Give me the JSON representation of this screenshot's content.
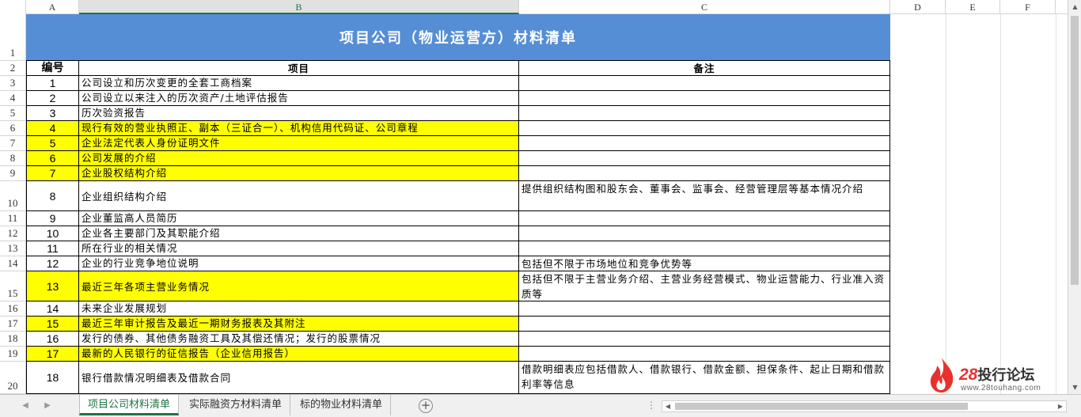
{
  "columns": [
    "A",
    "B",
    "C",
    "D",
    "E",
    "F"
  ],
  "rows": [
    "1",
    "2",
    "3",
    "4",
    "5",
    "6",
    "7",
    "8",
    "9",
    "10",
    "11",
    "12",
    "13",
    "14",
    "15",
    "16",
    "17",
    "18",
    "19",
    "20"
  ],
  "title": "项目公司（物业运营方）材料清单",
  "header": {
    "num": "编号",
    "item": "项目",
    "note": "备注"
  },
  "items": [
    {
      "num": "1",
      "item": "公司设立和历次变更的全套工商档案",
      "note": "",
      "highlight": false
    },
    {
      "num": "2",
      "item": "公司设立以来注入的历次资产/土地评估报告",
      "note": "",
      "highlight": false
    },
    {
      "num": "3",
      "item": "历次验资报告",
      "note": "",
      "highlight": false
    },
    {
      "num": "4",
      "item": "现行有效的营业执照正、副本（三证合一）、机构信用代码证、公司章程",
      "note": "",
      "highlight": true
    },
    {
      "num": "5",
      "item": "企业法定代表人身份证明文件",
      "note": "",
      "highlight": true
    },
    {
      "num": "6",
      "item": "公司发展的介绍",
      "note": "",
      "highlight": true
    },
    {
      "num": "7",
      "item": "企业股权结构介绍",
      "note": "",
      "highlight": true
    },
    {
      "num": "8",
      "item": "企业组织结构介绍",
      "note": "提供组织结构图和股东会、董事会、监事会、经营管理层等基本情况介绍",
      "highlight": false
    },
    {
      "num": "9",
      "item": "企业董监高人员简历",
      "note": "",
      "highlight": false
    },
    {
      "num": "10",
      "item": "企业各主要部门及其职能介绍",
      "note": "",
      "highlight": false
    },
    {
      "num": "11",
      "item": "所在行业的相关情况",
      "note": "",
      "highlight": false
    },
    {
      "num": "12",
      "item": "企业的行业竞争地位说明",
      "note": "包括但不限于市场地位和竞争优势等",
      "highlight": false
    },
    {
      "num": "13",
      "item": "最近三年各项主营业务情况",
      "note": "包括但不限于主营业务介绍、主营业务经营模式、物业运营能力、行业准入资质等",
      "highlight": true
    },
    {
      "num": "14",
      "item": "未来企业发展规划",
      "note": "",
      "highlight": false
    },
    {
      "num": "15",
      "item": "最近三年审计报告及最近一期财务报表及其附注",
      "note": "",
      "highlight": true
    },
    {
      "num": "16",
      "item": "发行的债券、其他债务融资工具及其偿还情况；发行的股票情况",
      "note": "",
      "highlight": false
    },
    {
      "num": "17",
      "item": "最新的人民银行的征信报告（企业信用报告）",
      "note": "",
      "highlight": true
    },
    {
      "num": "18",
      "item": "银行借款情况明细表及借款合同",
      "note": "借款明细表应包括借款人、借款银行、借款金额、担保条件、起止日期和借款利率等信息",
      "highlight": false
    }
  ],
  "sheet_tabs": [
    {
      "label": "项目公司材料清单",
      "active": true
    },
    {
      "label": "实际融资方材料清单",
      "active": false
    },
    {
      "label": "标的物业材料清单",
      "active": false
    }
  ],
  "watermark": {
    "brand_num": "28",
    "brand_text": "投行论坛",
    "url": "www.28touhang.com"
  },
  "colors": {
    "title_bg": "#558ed5",
    "highlight": "#ffff00",
    "excel_green": "#217346"
  }
}
